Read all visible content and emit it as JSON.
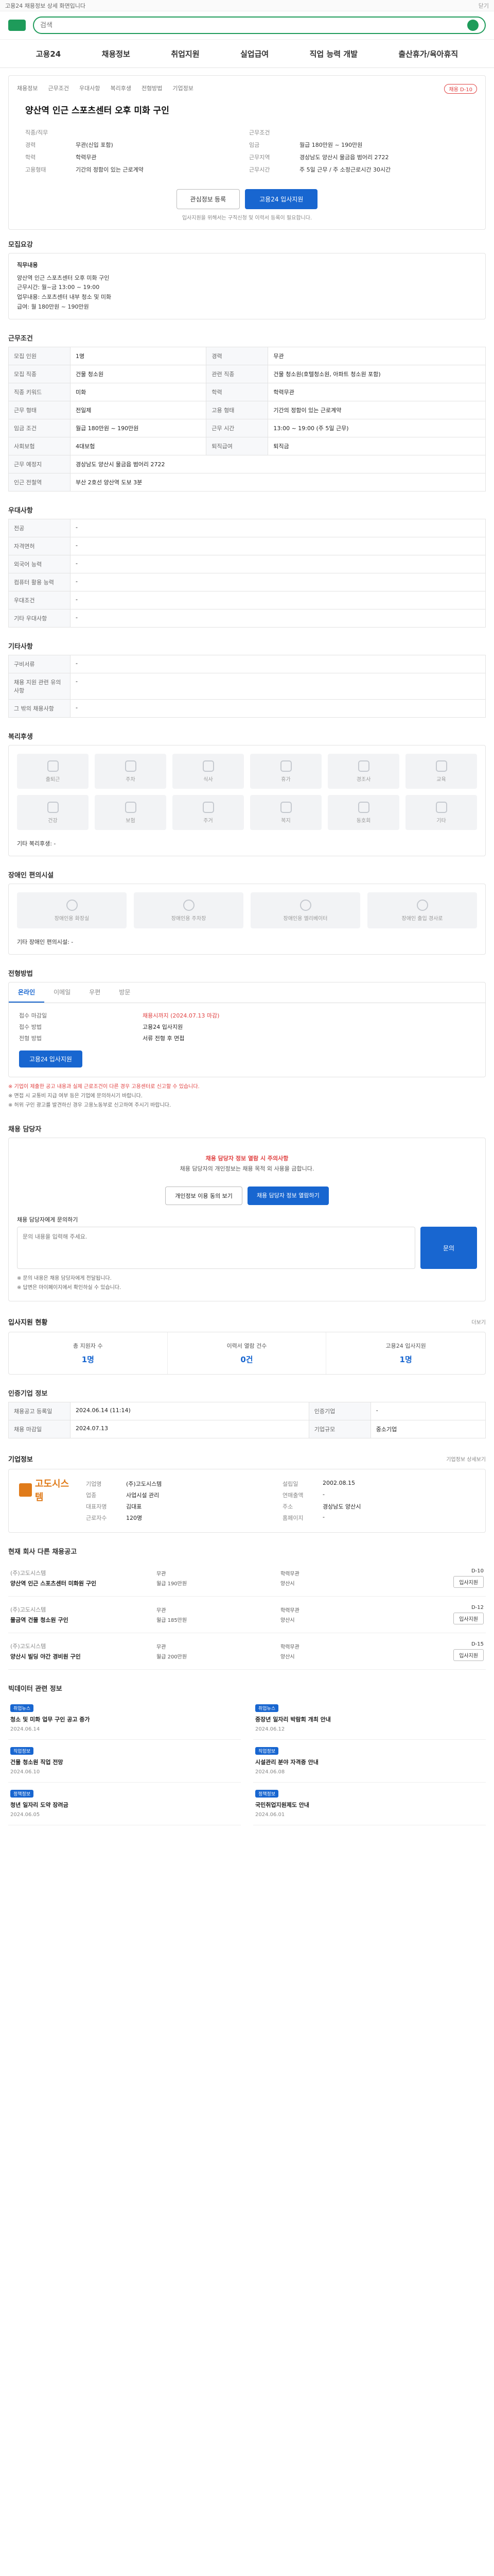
{
  "topnote": {
    "text": "고용24 채용정보 상세 화면입니다",
    "close": "닫기"
  },
  "header": {
    "search_placeholder": "검색",
    "search_value": ""
  },
  "gnb": [
    "고용24",
    "채용정보",
    "취업지원",
    "실업급여",
    "직업 능력 개발",
    "출산휴가/육아휴직"
  ],
  "job": {
    "breadcrumb": [
      "채용정보",
      "근무조건",
      "우대사항",
      "복리후생",
      "전형방법",
      "기업정보"
    ],
    "tag": "채용 D-10",
    "title": "양산역 인근 스포츠센터 오후 미화 구인",
    "details": [
      {
        "k": "직종/직무",
        "v": ""
      },
      {
        "k": "근무조건",
        "v": ""
      },
      {
        "k": "경력",
        "v": "무관(신입 포함)"
      },
      {
        "k": "임금",
        "v": "월급 180만원 ~ 190만원"
      },
      {
        "k": "학력",
        "v": "학력무관"
      },
      {
        "k": "근무지역",
        "v": "경상남도 양산시 물금읍 범어리 2722"
      },
      {
        "k": "고용형태",
        "v": "기간의 정함이 있는 근로계약"
      },
      {
        "k": "근무시간",
        "v": "주 5일 근무 / 주 소정근로시간 30시간"
      }
    ],
    "save_label": "관심정보 등록",
    "apply_label": "고용24 입사지원",
    "apply_note": "입사지원을 위해서는 구직신청 및 이력서 등록이 필요합니다."
  },
  "sections": {
    "detail": "모집요강",
    "conditions": "근무조건",
    "preferences": "우대사항",
    "other": "기타사항",
    "benefits": "복리후생",
    "facilities": "장애인 편의시설",
    "selection": "전형방법",
    "contact": "채용 담당자",
    "stats": "입사지원 현황",
    "applyinfo": "인증기업 정보",
    "company": "기업정보",
    "otherjobs": "현재 회사 다른 채용공고",
    "news": "빅데이터 관련 정보"
  },
  "detail_box": {
    "head": "직무내용",
    "lines": [
      "양산역 인근 스포츠센터 오후 미화 구인",
      "근무시간: 월~금 13:00 ~ 19:00",
      "업무내용: 스포츠센터 내부 청소 및 미화",
      "급여: 월 180만원 ~ 190만원"
    ]
  },
  "conditions": [
    {
      "k": "모집 인원",
      "v": "1명"
    },
    {
      "k": "경력",
      "v": "무관"
    },
    {
      "k": "모집 직종",
      "v": "건물 청소원"
    },
    {
      "k": "관련 직종",
      "v": "건물 청소원(호텔청소원, 아파트 청소원 포함)"
    },
    {
      "k": "직종 키워드",
      "v": "미화"
    },
    {
      "k": "학력",
      "v": "학력무관"
    },
    {
      "k": "근무 형태",
      "v": "전일제"
    },
    {
      "k": "고용 형태",
      "v": "기간의 정함이 있는 근로계약"
    },
    {
      "k": "임금 조건",
      "v": "월급 180만원 ~ 190만원"
    },
    {
      "k": "근무 시간",
      "v": "13:00 ~ 19:00 (주 5일 근무)"
    },
    {
      "k": "사회보험",
      "v": "4대보험"
    },
    {
      "k": "퇴직급여",
      "v": "퇴직금"
    },
    {
      "k": "근무 예정지",
      "v": "경상남도 양산시 물금읍 범어리 2722"
    },
    {
      "k": "인근 전철역",
      "v": "부산 2호선 양산역 도보 3분"
    }
  ],
  "preferences": [
    {
      "k": "전공",
      "v": "-"
    },
    {
      "k": "자격면허",
      "v": "-"
    },
    {
      "k": "외국어 능력",
      "v": "-"
    },
    {
      "k": "컴퓨터 활용 능력",
      "v": "-"
    },
    {
      "k": "우대조건",
      "v": "-"
    },
    {
      "k": "기타 우대사항",
      "v": "-"
    }
  ],
  "other": [
    {
      "k": "구비서류",
      "v": "-"
    },
    {
      "k": "채용 지원 관련 유의사항",
      "v": "-"
    },
    {
      "k": "그 밖의 채용사항",
      "v": "-"
    }
  ],
  "benefits": {
    "items": [
      "출퇴근",
      "주차",
      "식사",
      "휴가",
      "경조사",
      "교육",
      "건강",
      "보험",
      "주거",
      "복지",
      "동호회",
      "기타"
    ],
    "foot": "기타 복리후생: -"
  },
  "facilities": {
    "items": [
      "장애인용 화장실",
      "장애인용 주차장",
      "장애인용 엘리베이터",
      "장애인 출입 경사로"
    ],
    "foot": "기타 장애인 편의시설: -"
  },
  "selection": {
    "tabs": [
      "온라인",
      "이메일",
      "우편",
      "방문"
    ],
    "rows": [
      {
        "k": "접수 마감일",
        "v": "채용시까지 (2024.07.13 마감)"
      },
      {
        "k": "접수 방법",
        "v": "고용24 입사지원"
      },
      {
        "k": "전형 방법",
        "v": "서류 전형 후 면접"
      }
    ],
    "apply_label": "고용24 입사지원",
    "notes": [
      "※ 기업이 제출한 공고 내용과 실제 근로조건이 다른 경우 고용센터로 신고할 수 있습니다.",
      "※ 면접 시 교통비 지급 여부 등은 기업에 문의하시기 바랍니다.",
      "※ 허위 구인 광고를 발견하신 경우 고용노동부로 신고하여 주시기 바랍니다."
    ]
  },
  "contact": {
    "alert": "채용 담당자 정보 열람 시 주의사항",
    "text": "채용 담당자의 개인정보는 채용 목적 외 사용을 금합니다.",
    "btn1": "개인정보 이용 동의 보기",
    "btn2": "채용 담당자 정보 열람하기",
    "qa_label": "채용 담당자에게 문의하기",
    "qa_placeholder": "문의 내용을 입력해 주세요.",
    "send": "문의",
    "notes": [
      "※ 문의 내용은 채용 담당자에게 전달됩니다.",
      "※ 답변은 마이페이지에서 확인하실 수 있습니다."
    ]
  },
  "stats": {
    "more": "더보기",
    "items": [
      {
        "label": "총 지원자 수",
        "num": "1명"
      },
      {
        "label": "이력서 열람 건수",
        "num": "0건"
      },
      {
        "label": "고용24 입사지원",
        "num": "1명"
      }
    ]
  },
  "applyinfo": [
    {
      "k": "채용공고 등록일",
      "v": "2024.06.14 (11:14)"
    },
    {
      "k": "인증기업",
      "v": "-"
    },
    {
      "k": "채용 마감일",
      "v": "2024.07.13"
    },
    {
      "k": "기업규모",
      "v": "중소기업"
    }
  ],
  "company": {
    "logo_text": "고도시스템",
    "rows": [
      {
        "k": "기업명",
        "v": "(주)고도시스템"
      },
      {
        "k": "업종",
        "v": "사업시설 관리"
      },
      {
        "k": "대표자명",
        "v": "김대표"
      },
      {
        "k": "근로자수",
        "v": "120명"
      },
      {
        "k": "설립일",
        "v": "2002.08.15"
      },
      {
        "k": "연매출액",
        "v": "-"
      },
      {
        "k": "주소",
        "v": "경상남도 양산시"
      },
      {
        "k": "홈페이지",
        "v": "-"
      }
    ],
    "more": "기업정보 상세보기"
  },
  "otherjobs": [
    {
      "co": "(주)고도시스템",
      "t": "양산역 인근 스포츠센터 미화원 구인",
      "m": [
        "무관",
        "학력무관",
        "월급 190만원",
        "양산시"
      ],
      "dday": "D-10",
      "b": "입사지원"
    },
    {
      "co": "(주)고도시스템",
      "t": "물금역 건물 청소원 구인",
      "m": [
        "무관",
        "학력무관",
        "월급 185만원",
        "양산시"
      ],
      "dday": "D-12",
      "b": "입사지원"
    },
    {
      "co": "(주)고도시스템",
      "t": "양산시 빌딩 야간 경비원 구인",
      "m": [
        "무관",
        "학력무관",
        "월급 200만원",
        "양산시"
      ],
      "dday": "D-15",
      "b": "입사지원"
    }
  ],
  "news": [
    {
      "badge": "취업뉴스",
      "t": "청소 및 미화 업무 구인 공고 증가",
      "m": "2024.06.14"
    },
    {
      "badge": "취업뉴스",
      "t": "중장년 일자리 박람회 개최 안내",
      "m": "2024.06.12"
    },
    {
      "badge": "직업정보",
      "t": "건물 청소원 직업 전망",
      "m": "2024.06.10"
    },
    {
      "badge": "직업정보",
      "t": "시설관리 분야 자격증 안내",
      "m": "2024.06.08"
    },
    {
      "badge": "정책정보",
      "t": "청년 일자리 도약 장려금",
      "m": "2024.06.05"
    },
    {
      "badge": "정책정보",
      "t": "국민취업지원제도 안내",
      "m": "2024.06.01"
    }
  ]
}
